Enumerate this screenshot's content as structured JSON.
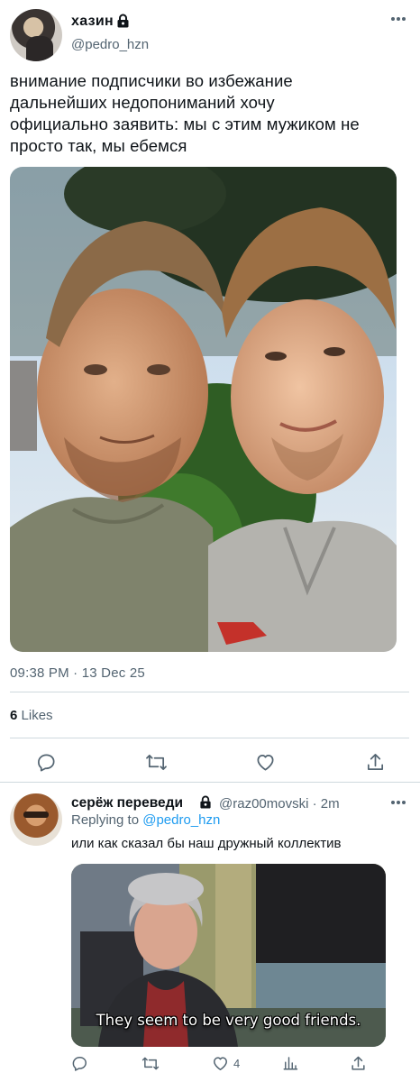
{
  "tweet": {
    "display_name": "хазин",
    "handle": "@pedro_hzn",
    "text_lines": [
      "внимание подписчики во избежание",
      "дальнейших недопониманий хочу",
      "официально заявить: мы с этим мужиком не",
      "просто так, мы ебемся"
    ],
    "timestamp": "09:38 PM · 13 Dec 25",
    "likes_count": "6",
    "likes_label": "Likes"
  },
  "reply": {
    "display_name": "серёж переведи",
    "handle_time": "@raz00movski · 2m",
    "replying_prefix": "Replying to",
    "replying_to": "@pedro_hzn",
    "text": "или как сказал бы наш дружный коллектив",
    "gif_caption": "They seem to be very good friends.",
    "like_count": "4"
  },
  "icons": {
    "protected": "lock-icon",
    "more": "more-icon",
    "reply": "reply-icon",
    "retweet": "retweet-icon",
    "like": "heart-icon",
    "share": "share-icon",
    "analytics": "analytics-icon"
  },
  "colors": {
    "accent": "#1d9bf0",
    "secondary_text": "#536471",
    "divider": "#cfd9de"
  }
}
